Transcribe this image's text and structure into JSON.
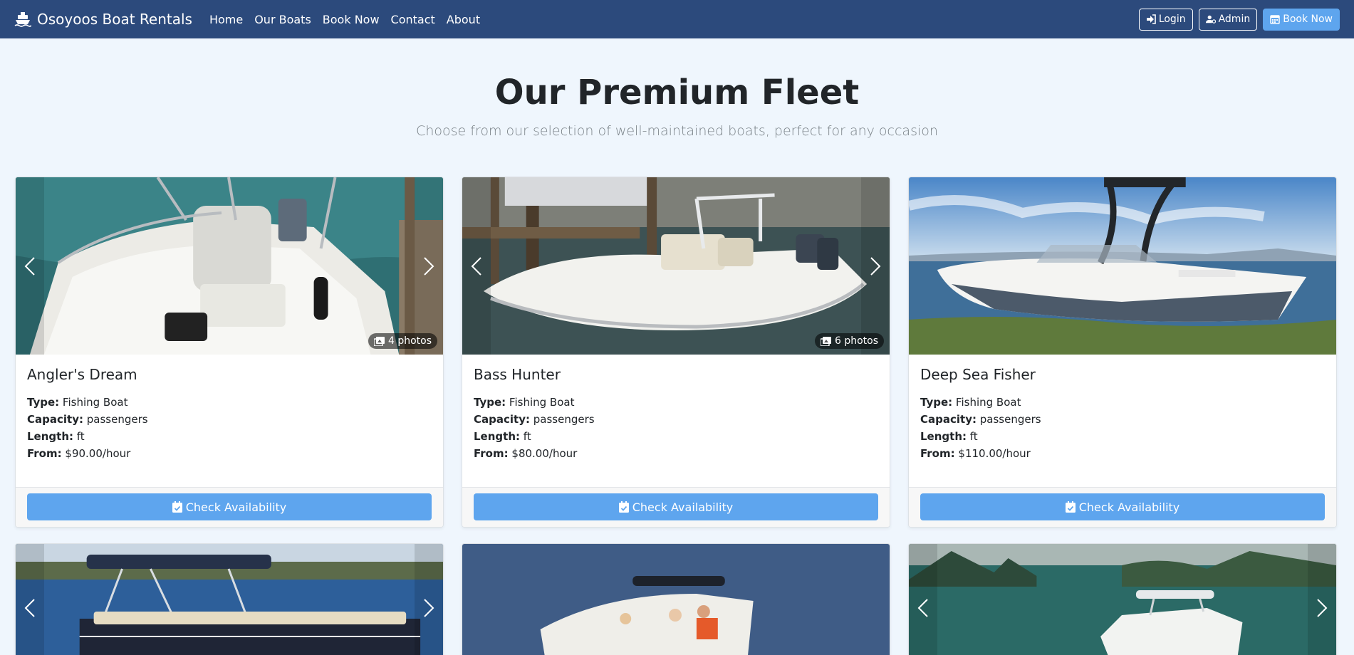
{
  "navbar": {
    "brand": "Osoyoos Boat Rentals",
    "links": [
      "Home",
      "Our Boats",
      "Book Now",
      "Contact",
      "About"
    ],
    "login_label": "Login",
    "admin_label": "Admin",
    "book_label": "Book Now"
  },
  "hero": {
    "title": "Our Premium Fleet",
    "subtitle": "Choose from our selection of well-maintained boats, perfect for any occasion"
  },
  "labels": {
    "type": "Type:",
    "capacity": "Capacity:",
    "length": "Length:",
    "from": "From:",
    "check_availability": "Check Availability"
  },
  "boats": [
    {
      "name": "Angler's Dream",
      "type": "Fishing Boat",
      "capacity": "passengers",
      "length": "ft",
      "price": "$90.00/hour",
      "photos": "4 photos"
    },
    {
      "name": "Bass Hunter",
      "type": "Fishing Boat",
      "capacity": "passengers",
      "length": "ft",
      "price": "$80.00/hour",
      "photos": "6 photos"
    },
    {
      "name": "Deep Sea Fisher",
      "type": "Fishing Boat",
      "capacity": "passengers",
      "length": "ft",
      "price": "$110.00/hour"
    }
  ],
  "colors": {
    "navbar": "#2c4a7c",
    "primary_button": "#5ea5ee",
    "page_background": "#eff6fd"
  }
}
